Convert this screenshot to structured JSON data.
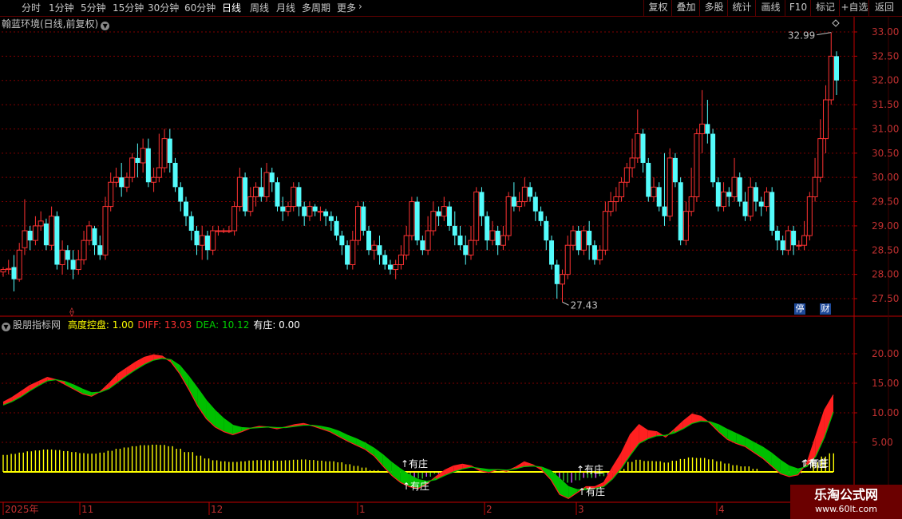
{
  "toolbar": {
    "periods": [
      "分时",
      "1分钟",
      "5分钟",
      "15分钟",
      "30分钟",
      "60分钟",
      "日线",
      "周线",
      "月线",
      "多周期",
      "更多"
    ],
    "active_period": "日线",
    "more_arrow": "›",
    "right_buttons": [
      "复权",
      "叠加",
      "多股",
      "统计",
      "画线",
      "F10",
      "标记",
      "+自选",
      "返回"
    ]
  },
  "main_chart": {
    "title": "翰蓝环境(日线,前复权)",
    "high_label": "32.99",
    "low_label": "27.43",
    "y_ticks": [
      "33.00",
      "32.50",
      "32.00",
      "31.50",
      "31.00",
      "30.50",
      "30.00",
      "29.50",
      "29.00",
      "28.50",
      "28.00",
      "27.50"
    ],
    "tags": [
      "停",
      "财"
    ]
  },
  "indicator": {
    "name": "股朋指标网",
    "items": [
      {
        "label": "高度控盘:",
        "value": "1.00",
        "color": "#ffff00"
      },
      {
        "label": "DIFF:",
        "value": "13.03",
        "color": "#ff3030"
      },
      {
        "label": "DEA:",
        "value": "10.12",
        "color": "#00d000"
      },
      {
        "label": "有庄:",
        "value": "0.00",
        "color": "#ffffff"
      }
    ],
    "y_ticks": [
      "20.00",
      "15.00",
      "10.00",
      "5.00"
    ],
    "annotations": [
      "有庄",
      "有庄",
      "有庄",
      "有庄",
      "有庄",
      "有庄"
    ]
  },
  "x_axis": {
    "labels": [
      "2025年",
      "11",
      "12",
      "1",
      "2",
      "3",
      "4"
    ]
  },
  "watermark": {
    "title": "乐淘公式网",
    "url": "www.60lt.com"
  },
  "colors": {
    "up": "#ff3232",
    "down": "#54fcfc",
    "diff": "#ff2020",
    "dea": "#00c000",
    "grid": "#800000",
    "yellow": "#ffff00",
    "purple": "#cc55ff",
    "axis": "#c00000"
  },
  "chart_data": [
    {
      "type": "candlestick",
      "y_axis_range": [
        27.25,
        33.3
      ],
      "high": 32.99,
      "low": 27.43,
      "candles": [
        [
          28.05,
          28.1,
          27.95,
          28.15
        ],
        [
          28.1,
          28.12,
          28.0,
          28.3
        ],
        [
          28.15,
          27.9,
          27.65,
          28.4
        ],
        [
          27.9,
          28.5,
          27.85,
          28.65
        ],
        [
          28.55,
          28.9,
          28.4,
          29.55
        ],
        [
          28.9,
          28.7,
          28.5,
          29.0
        ],
        [
          28.7,
          29.0,
          28.6,
          29.2
        ],
        [
          29.0,
          29.1,
          28.9,
          29.3
        ],
        [
          29.05,
          28.6,
          28.5,
          29.15
        ],
        [
          28.6,
          29.2,
          28.5,
          29.4
        ],
        [
          29.2,
          28.2,
          28.1,
          29.3
        ],
        [
          28.2,
          28.5,
          28.0,
          28.7
        ],
        [
          28.5,
          28.3,
          28.1,
          28.6
        ],
        [
          28.3,
          28.1,
          27.9,
          28.5
        ],
        [
          28.1,
          28.3,
          28.0,
          28.5
        ],
        [
          28.3,
          28.7,
          28.2,
          28.9
        ],
        [
          28.7,
          29.0,
          28.6,
          29.1
        ],
        [
          28.95,
          28.6,
          28.4,
          29.0
        ],
        [
          28.6,
          28.4,
          28.3,
          28.8
        ],
        [
          28.4,
          29.4,
          28.3,
          29.6
        ],
        [
          29.4,
          29.9,
          29.3,
          30.1
        ],
        [
          29.9,
          30.0,
          29.8,
          30.2
        ],
        [
          30.0,
          29.8,
          29.6,
          30.3
        ],
        [
          29.8,
          30.0,
          29.7,
          30.1
        ],
        [
          30.0,
          30.4,
          29.9,
          30.5
        ],
        [
          30.4,
          30.3,
          30.0,
          30.7
        ],
        [
          30.3,
          30.6,
          30.1,
          30.8
        ],
        [
          30.6,
          29.9,
          29.8,
          30.8
        ],
        [
          29.9,
          30.0,
          29.7,
          30.2
        ],
        [
          30.0,
          30.2,
          29.9,
          30.9
        ],
        [
          30.2,
          30.8,
          30.1,
          31.0
        ],
        [
          30.8,
          30.3,
          30.1,
          31.0
        ],
        [
          30.3,
          29.8,
          29.7,
          30.4
        ],
        [
          29.8,
          29.5,
          29.3,
          29.9
        ],
        [
          29.5,
          29.2,
          29.0,
          29.6
        ],
        [
          29.2,
          28.9,
          28.7,
          29.3
        ],
        [
          28.9,
          28.6,
          28.4,
          29.0
        ],
        [
          28.6,
          28.8,
          28.3,
          29.0
        ],
        [
          28.8,
          28.5,
          28.3,
          28.9
        ],
        [
          28.5,
          28.9,
          28.4,
          29.0
        ],
        [
          28.9,
          28.9,
          28.8,
          29.0
        ],
        [
          28.9,
          28.9,
          28.85,
          28.95
        ],
        [
          28.9,
          28.9,
          28.85,
          29.0
        ],
        [
          28.9,
          29.4,
          28.8,
          29.5
        ],
        [
          29.4,
          30.0,
          29.3,
          30.2
        ],
        [
          30.0,
          29.3,
          29.2,
          30.1
        ],
        [
          29.3,
          29.6,
          29.2,
          29.8
        ],
        [
          29.6,
          29.8,
          29.4,
          29.9
        ],
        [
          29.8,
          29.6,
          29.5,
          30.2
        ],
        [
          29.6,
          30.1,
          29.5,
          30.3
        ],
        [
          30.1,
          29.9,
          29.7,
          30.2
        ],
        [
          29.9,
          29.4,
          29.3,
          30.0
        ],
        [
          29.4,
          29.3,
          29.1,
          29.6
        ],
        [
          29.3,
          29.4,
          29.2,
          29.5
        ],
        [
          29.4,
          29.8,
          29.3,
          29.9
        ],
        [
          29.8,
          29.4,
          29.2,
          29.9
        ],
        [
          29.4,
          29.2,
          29.0,
          29.5
        ],
        [
          29.2,
          29.4,
          29.1,
          29.5
        ],
        [
          29.4,
          29.3,
          29.2,
          29.45
        ],
        [
          29.3,
          29.3,
          29.1,
          29.4
        ],
        [
          29.3,
          29.2,
          29.0,
          29.35
        ],
        [
          29.2,
          29.1,
          28.9,
          29.3
        ],
        [
          29.1,
          28.8,
          28.7,
          29.2
        ],
        [
          28.8,
          28.6,
          28.4,
          28.9
        ],
        [
          28.6,
          28.2,
          28.1,
          28.7
        ],
        [
          28.2,
          28.7,
          28.1,
          28.9
        ],
        [
          28.7,
          29.4,
          28.6,
          29.5
        ],
        [
          29.4,
          28.9,
          28.8,
          29.5
        ],
        [
          28.9,
          28.5,
          28.4,
          29.0
        ],
        [
          28.5,
          28.6,
          28.3,
          28.7
        ],
        [
          28.6,
          28.4,
          28.2,
          28.8
        ],
        [
          28.4,
          28.2,
          28.1,
          28.5
        ],
        [
          28.2,
          28.1,
          28.0,
          28.3
        ],
        [
          28.1,
          28.2,
          27.9,
          28.3
        ],
        [
          28.2,
          28.4,
          28.1,
          28.6
        ],
        [
          28.4,
          28.8,
          28.3,
          29.0
        ],
        [
          28.8,
          29.5,
          28.7,
          29.6
        ],
        [
          29.5,
          28.7,
          28.6,
          29.6
        ],
        [
          28.7,
          28.5,
          28.4,
          28.8
        ],
        [
          28.5,
          28.9,
          28.4,
          29.2
        ],
        [
          28.9,
          29.3,
          28.8,
          29.5
        ],
        [
          29.3,
          29.2,
          29.0,
          29.4
        ],
        [
          29.2,
          29.4,
          29.1,
          29.6
        ],
        [
          29.4,
          29.0,
          28.9,
          29.5
        ],
        [
          29.0,
          28.8,
          28.6,
          29.3
        ],
        [
          28.8,
          28.6,
          28.5,
          29.0
        ],
        [
          28.6,
          28.4,
          28.2,
          28.8
        ],
        [
          28.4,
          28.7,
          28.3,
          29.0
        ],
        [
          28.7,
          29.7,
          28.6,
          29.8
        ],
        [
          29.7,
          29.2,
          29.0,
          29.8
        ],
        [
          29.2,
          28.7,
          28.5,
          29.3
        ],
        [
          28.7,
          28.9,
          28.6,
          29.1
        ],
        [
          28.9,
          28.6,
          28.4,
          29.0
        ],
        [
          28.6,
          28.8,
          28.5,
          29.0
        ],
        [
          28.8,
          29.6,
          28.7,
          29.7
        ],
        [
          29.6,
          29.4,
          29.3,
          29.9
        ],
        [
          29.4,
          29.5,
          29.3,
          29.7
        ],
        [
          29.5,
          29.8,
          29.4,
          30.0
        ],
        [
          29.8,
          29.6,
          29.5,
          29.9
        ],
        [
          29.6,
          29.3,
          29.1,
          29.7
        ],
        [
          29.3,
          29.1,
          29.0,
          29.4
        ],
        [
          29.1,
          28.7,
          28.5,
          29.2
        ],
        [
          28.7,
          28.2,
          28.1,
          28.8
        ],
        [
          28.2,
          27.8,
          27.5,
          28.3
        ],
        [
          27.8,
          28.0,
          27.43,
          28.1
        ],
        [
          28.0,
          28.6,
          27.9,
          28.8
        ],
        [
          28.6,
          28.9,
          28.5,
          29.0
        ],
        [
          28.9,
          28.5,
          28.4,
          29.0
        ],
        [
          28.5,
          28.9,
          28.4,
          29.0
        ],
        [
          28.9,
          28.6,
          28.3,
          29.1
        ],
        [
          28.6,
          28.3,
          28.2,
          28.7
        ],
        [
          28.3,
          28.5,
          28.2,
          28.6
        ],
        [
          28.5,
          29.3,
          28.4,
          29.5
        ],
        [
          29.3,
          29.5,
          29.2,
          29.7
        ],
        [
          29.5,
          29.6,
          29.3,
          29.8
        ],
        [
          29.6,
          29.9,
          29.5,
          30.0
        ],
        [
          29.9,
          30.2,
          29.8,
          30.3
        ],
        [
          30.2,
          30.4,
          30.0,
          30.8
        ],
        [
          30.4,
          30.9,
          30.3,
          31.4
        ],
        [
          30.9,
          30.3,
          30.1,
          31.0
        ],
        [
          30.3,
          29.6,
          29.5,
          30.4
        ],
        [
          29.6,
          29.8,
          29.5,
          30.0
        ],
        [
          29.8,
          29.4,
          29.3,
          29.9
        ],
        [
          29.4,
          29.2,
          29.0,
          30.5
        ],
        [
          29.2,
          30.4,
          29.1,
          30.6
        ],
        [
          30.4,
          29.9,
          29.8,
          30.5
        ],
        [
          29.9,
          28.7,
          28.6,
          30.0
        ],
        [
          28.7,
          29.3,
          28.6,
          29.5
        ],
        [
          29.3,
          29.6,
          29.2,
          30.2
        ],
        [
          29.6,
          30.9,
          29.5,
          31.0
        ],
        [
          30.9,
          31.1,
          30.5,
          31.8
        ],
        [
          31.1,
          30.9,
          30.7,
          31.6
        ],
        [
          30.9,
          29.9,
          29.8,
          31.0
        ],
        [
          29.9,
          29.4,
          29.3,
          30.0
        ],
        [
          29.4,
          29.7,
          29.3,
          29.9
        ],
        [
          29.7,
          29.6,
          29.4,
          29.8
        ],
        [
          29.6,
          30.0,
          29.5,
          30.4
        ],
        [
          30.0,
          29.5,
          29.4,
          30.1
        ],
        [
          29.5,
          29.2,
          29.1,
          29.7
        ],
        [
          29.2,
          29.8,
          29.1,
          30.0
        ],
        [
          29.8,
          29.5,
          29.3,
          29.9
        ],
        [
          29.5,
          29.4,
          29.2,
          29.6
        ],
        [
          29.4,
          29.7,
          29.3,
          29.8
        ],
        [
          29.7,
          28.9,
          28.8,
          29.8
        ],
        [
          28.9,
          28.7,
          28.5,
          29.0
        ],
        [
          28.7,
          28.5,
          28.4,
          28.8
        ],
        [
          28.5,
          28.9,
          28.4,
          29.0
        ],
        [
          28.9,
          28.6,
          28.4,
          29.0
        ],
        [
          28.6,
          28.6,
          28.5,
          28.7
        ],
        [
          28.6,
          28.8,
          28.5,
          29.1
        ],
        [
          28.8,
          29.6,
          28.7,
          29.7
        ],
        [
          29.6,
          30.0,
          29.5,
          30.4
        ],
        [
          30.0,
          30.8,
          29.9,
          31.2
        ],
        [
          30.8,
          31.6,
          30.5,
          31.9
        ],
        [
          31.6,
          32.5,
          31.5,
          32.99
        ],
        [
          32.5,
          32.0,
          31.7,
          32.6
        ]
      ]
    },
    {
      "type": "line",
      "y_axis_range": [
        -6,
        24
      ],
      "series": [
        {
          "name": "DIFF",
          "values": [
            11.8,
            12.6,
            13.6,
            14.6,
            15.3,
            16.0,
            15.6,
            14.8,
            14.0,
            13.2,
            12.8,
            13.6,
            15.0,
            16.6,
            17.6,
            18.6,
            19.4,
            19.8,
            19.6,
            18.6,
            16.6,
            14.0,
            11.2,
            9.0,
            7.6,
            6.8,
            6.3,
            6.8,
            7.4,
            7.7,
            7.6,
            7.3,
            7.6,
            8.0,
            8.2,
            7.8,
            7.3,
            6.8,
            6.0,
            5.2,
            4.5,
            3.8,
            2.7,
            1.0,
            -0.6,
            -1.8,
            -2.5,
            -2.8,
            -2.0,
            -0.8,
            0.3,
            1.0,
            1.3,
            1.0,
            0.2,
            -0.1,
            0.4,
            0.1,
            0.8,
            1.7,
            1.2,
            0.3,
            -1.3,
            -3.8,
            -4.5,
            -3.5,
            -2.5,
            -2.5,
            -1.8,
            0.8,
            3.2,
            6.3,
            8.0,
            7.0,
            6.8,
            5.9,
            7.2,
            8.6,
            9.8,
            9.4,
            8.3,
            6.8,
            5.5,
            4.8,
            4.3,
            3.3,
            2.3,
            1.0,
            -0.3,
            -0.8,
            -0.5,
            1.5,
            6.0,
            10.5,
            13.03
          ]
        },
        {
          "name": "DEA",
          "values": [
            11.3,
            11.9,
            12.7,
            13.7,
            14.6,
            15.4,
            15.6,
            15.3,
            14.7,
            14.0,
            13.4,
            13.5,
            14.1,
            15.2,
            16.3,
            17.3,
            18.2,
            18.9,
            19.2,
            19.0,
            18.0,
            16.2,
            14.2,
            12.1,
            10.4,
            9.0,
            7.9,
            7.5,
            7.4,
            7.5,
            7.6,
            7.5,
            7.5,
            7.7,
            7.9,
            7.9,
            7.7,
            7.4,
            6.9,
            6.2,
            5.6,
            4.9,
            4.0,
            2.9,
            1.6,
            0.5,
            -0.5,
            -1.3,
            -1.6,
            -1.3,
            -0.6,
            0.0,
            0.5,
            0.8,
            0.6,
            0.4,
            0.4,
            0.3,
            0.5,
            0.9,
            1.0,
            0.8,
            0.2,
            -1.1,
            -2.5,
            -3.0,
            -3.0,
            -2.8,
            -2.5,
            -1.2,
            0.6,
            2.8,
            4.8,
            5.6,
            6.1,
            6.2,
            6.6,
            7.3,
            8.2,
            8.6,
            8.5,
            8.0,
            7.2,
            6.5,
            5.8,
            5.0,
            4.2,
            3.2,
            2.0,
            1.0,
            0.5,
            0.9,
            2.6,
            5.9,
            10.12
          ]
        }
      ]
    }
  ]
}
